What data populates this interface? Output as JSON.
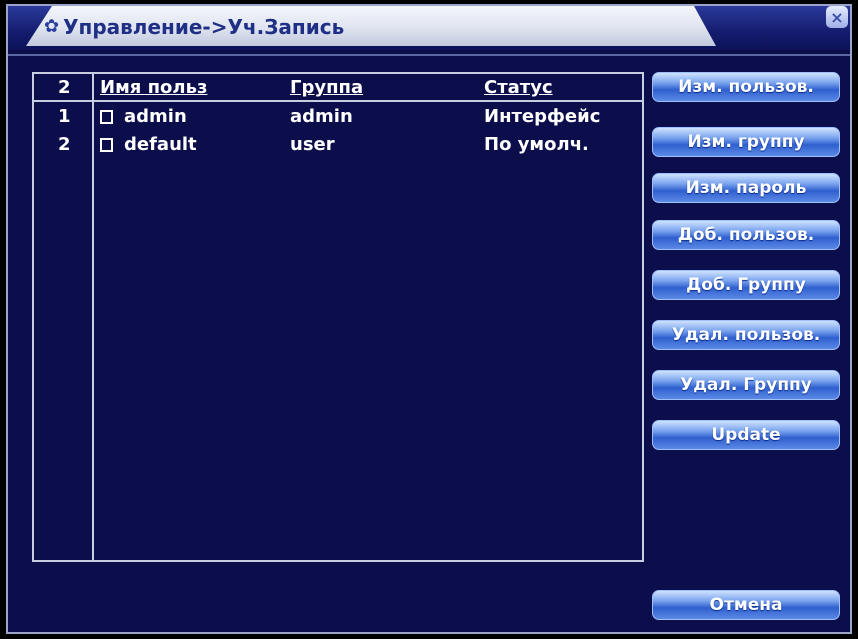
{
  "window": {
    "title": "Управление->Уч.Запись",
    "close_symbol": "×"
  },
  "table": {
    "count": "2",
    "headers": {
      "name": "Имя польз",
      "group": "Группа",
      "status": "Статус"
    },
    "rows": [
      {
        "num": "1",
        "name": "admin",
        "group": "admin",
        "status": "Интерфейс"
      },
      {
        "num": "2",
        "name": "default",
        "group": "user",
        "status": "По умолч."
      }
    ]
  },
  "buttons": {
    "modify_user": "Изм. пользов.",
    "modify_group": "Изм. группу",
    "modify_password": "Изм. пароль",
    "add_user": "Доб. пользов.",
    "add_group": "Доб. Группу",
    "delete_user": "Удал. пользов.",
    "delete_group": "Удал. Группу",
    "update": "Update",
    "cancel": "Отмена"
  },
  "icons": {
    "title_icon": "user-settings-icon",
    "close_icon": "close-icon"
  },
  "colors": {
    "background": "#0b0e4a",
    "button_gradient_top": "#cfe2ff",
    "button_gradient_bottom": "#2f5fcf",
    "text": "#ffffff",
    "title_text": "#1f2f86"
  }
}
